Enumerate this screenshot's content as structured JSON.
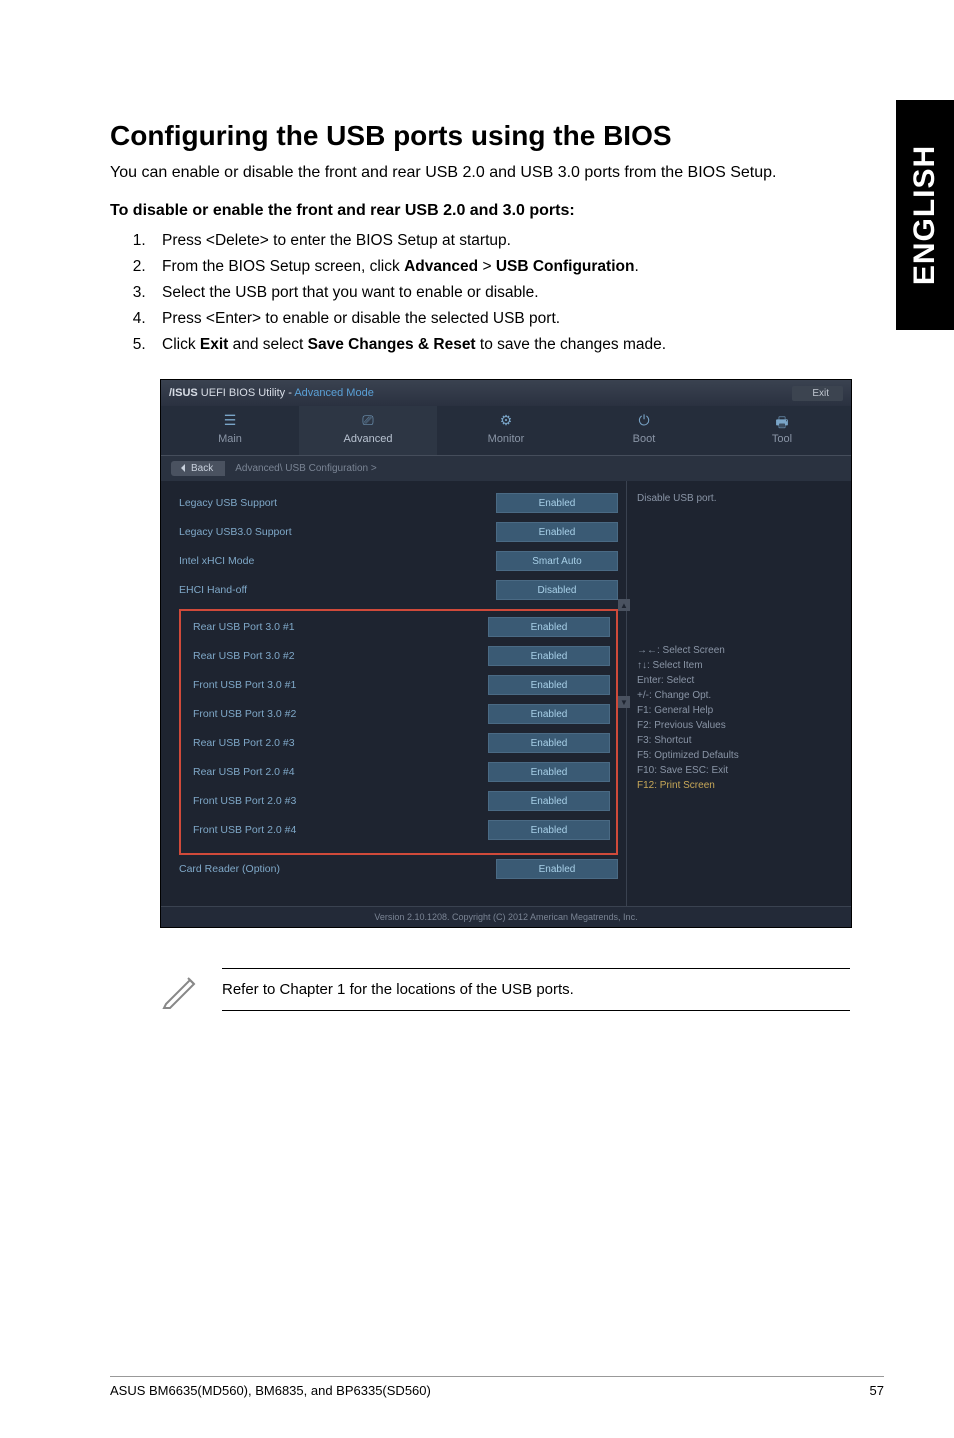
{
  "side_tab": "ENGLISH",
  "heading": "Configuring the USB ports using the BIOS",
  "intro": "You can enable or disable the front and rear USB 2.0 and USB 3.0 ports from the BIOS Setup.",
  "subheading": "To disable or enable the front and rear USB 2.0 and 3.0 ports:",
  "steps": {
    "s1": "Press <Delete> to enter the BIOS Setup at startup.",
    "s2a": "From the BIOS Setup screen, click ",
    "s2b": "Advanced",
    "s2c": " > ",
    "s2d": "USB Configuration",
    "s2e": ".",
    "s3": "Select the USB port that you want to enable or disable.",
    "s4": "Press <Enter> to enable or disable the selected USB port.",
    "s5a": "Click ",
    "s5b": "Exit",
    "s5c": " and select ",
    "s5d": "Save Changes & Reset",
    "s5e": " to save the changes made."
  },
  "bios": {
    "brand": "/ISUS",
    "title_a": " UEFI BIOS Utility - ",
    "title_b": "Advanced Mode",
    "exit": "Exit",
    "tabs": {
      "main": "Main",
      "advanced": "Advanced",
      "monitor": "Monitor",
      "boot": "Boot",
      "tool": "Tool"
    },
    "back": "Back",
    "crumb": "Advanced\\ USB Configuration >",
    "rows_top": [
      {
        "label": "Legacy USB Support",
        "val": "Enabled"
      },
      {
        "label": "Legacy USB3.0 Support",
        "val": "Enabled"
      },
      {
        "label": "Intel xHCI Mode",
        "val": "Smart Auto"
      },
      {
        "label": "EHCI Hand-off",
        "val": "Disabled"
      }
    ],
    "rows_box": [
      {
        "label": "Rear  USB Port 3.0 #1",
        "val": "Enabled"
      },
      {
        "label": "Rear  USB Port 3.0 #2",
        "val": "Enabled"
      },
      {
        "label": "Front USB Port 3.0 #1",
        "val": "Enabled"
      },
      {
        "label": "Front USB Port 3.0 #2",
        "val": "Enabled"
      },
      {
        "label": "Rear  USB Port 2.0 #3",
        "val": "Enabled"
      },
      {
        "label": "Rear  USB Port 2.0 #4",
        "val": "Enabled"
      },
      {
        "label": "Front USB Port 2.0 #3",
        "val": "Enabled"
      },
      {
        "label": "Front USB Port 2.0 #4",
        "val": "Enabled"
      }
    ],
    "row_after": {
      "label": "Card  Reader (Option)",
      "val": "Enabled"
    },
    "help_top": "Disable USB port.",
    "help_keys": [
      "→←: Select Screen",
      "↑↓: Select Item",
      "Enter: Select",
      "+/-: Change Opt.",
      "F1: General Help",
      "F2: Previous Values",
      "F3: Shortcut",
      "F5: Optimized Defaults",
      "F10: Save  ESC: Exit",
      "F12: Print Screen"
    ],
    "footer": "Version 2.10.1208. Copyright (C) 2012 American Megatrends, Inc."
  },
  "note": "Refer to Chapter 1 for the locations of the USB ports.",
  "page_footer_left": "ASUS BM6635(MD560), BM6835, and BP6335(SD560)",
  "page_footer_right": "57"
}
